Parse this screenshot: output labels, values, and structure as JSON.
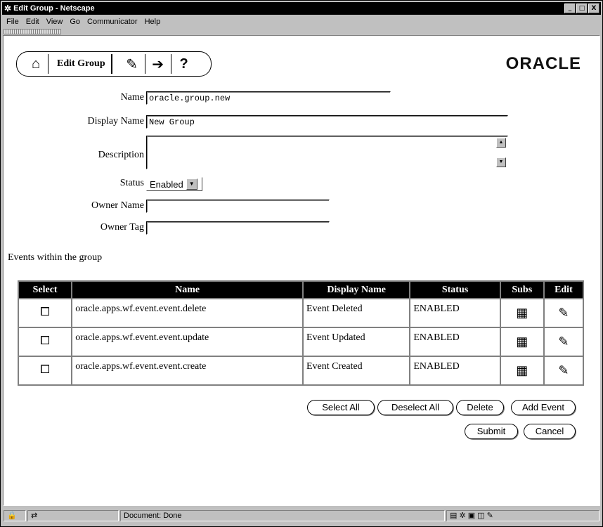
{
  "window": {
    "title": "Edit Group - Netscape",
    "controls": {
      "minimize": "_",
      "maximize": "□",
      "close": "X"
    }
  },
  "menu": [
    "File",
    "Edit",
    "View",
    "Go",
    "Communicator",
    "Help"
  ],
  "toolbar": {
    "title": "Edit Group",
    "help_glyph": "?",
    "brand": "ORACLE"
  },
  "form": {
    "name_label": "Name",
    "name_value": "oracle.group.new",
    "display_name_label": "Display Name",
    "display_name_value": "New Group",
    "description_label": "Description",
    "description_value": "",
    "status_label": "Status",
    "status_value": "Enabled",
    "owner_name_label": "Owner Name",
    "owner_name_value": "",
    "owner_tag_label": "Owner Tag",
    "owner_tag_value": ""
  },
  "events": {
    "section_title": "Events within the group",
    "headers": [
      "Select",
      "Name",
      "Display Name",
      "Status",
      "Subs",
      "Edit"
    ],
    "rows": [
      {
        "name": "oracle.apps.wf.event.event.delete",
        "display_name": "Event Deleted",
        "status": "ENABLED"
      },
      {
        "name": "oracle.apps.wf.event.event.update",
        "display_name": "Event Updated",
        "status": "ENABLED"
      },
      {
        "name": "oracle.apps.wf.event.event.create",
        "display_name": "Event Created",
        "status": "ENABLED"
      }
    ]
  },
  "buttons": {
    "select_all": "Select All",
    "deselect_all": "Deselect All",
    "delete": "Delete",
    "add_event": "Add Event",
    "submit": "Submit",
    "cancel": "Cancel"
  },
  "status_bar": {
    "text": "Document: Done"
  },
  "icons": {
    "app": "netscape-icon",
    "home": "home-icon",
    "globe": "globe-icon",
    "exit": "exit-door-icon",
    "subs": "subscriptions-icon",
    "edit": "pencil-icon"
  }
}
